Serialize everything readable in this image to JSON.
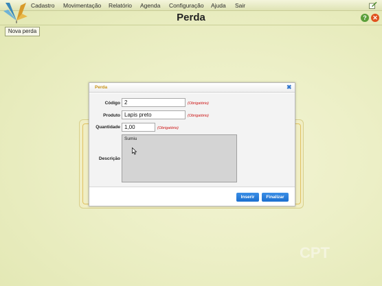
{
  "menu": {
    "items": [
      "Cadastro",
      "Movimentação",
      "Relatório",
      "Agenda",
      "Configuração",
      "Ajuda",
      "Sair"
    ]
  },
  "header": {
    "title": "Perda",
    "help_label": "?",
    "close_label": "✕"
  },
  "toolbar": {
    "new_label": "Nova perda"
  },
  "dialog": {
    "title": "Perda",
    "close_glyph": "✖",
    "fields": {
      "codigo": {
        "label": "Código",
        "value": "2",
        "required": "(Obrigatório)"
      },
      "produto": {
        "label": "Produto",
        "value": "Lapis preto",
        "required": "(Obrigatório)"
      },
      "quantidade": {
        "label": "Quantidade",
        "value": "1,00",
        "required": "(Obrigatório)"
      },
      "descricao": {
        "label": "Descrição",
        "value": "Sumiu"
      }
    },
    "buttons": {
      "insert_label": "Inserir",
      "finish_label": "Finalizar"
    }
  },
  "watermark": "CPT",
  "colors": {
    "accent_blue": "#1c6fcf",
    "required_red": "#cc1111",
    "dialog_title": "#c79215"
  }
}
